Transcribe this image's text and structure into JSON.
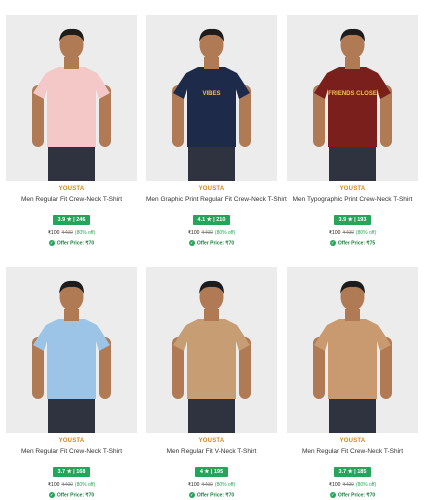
{
  "products": [
    {
      "brand": "YOUSTA",
      "name": "Men Regular Fit Crew-Neck T-Shirt",
      "rating": "3.9 ★ | 246",
      "price": "₹100",
      "mrp": "₹499",
      "discount": "(80% off)",
      "offer": "Offer Price: ₹70",
      "shirt_color": "#f3c8c6",
      "shirt_label": ""
    },
    {
      "brand": "YOUSTA",
      "name": "Men Graphic Print Regular Fit Crew-Neck T-Shirt",
      "rating": "4.1 ★ | 210",
      "price": "₹100",
      "mrp": "₹499",
      "discount": "(80% off)",
      "offer": "Offer Price: ₹70",
      "shirt_color": "#1e2a4a",
      "shirt_label": "VIBES"
    },
    {
      "brand": "YOUSTA",
      "name": "Men Typographic Print Crew-Neck T-Shirt",
      "rating": "3.9 ★ | 193",
      "price": "₹100",
      "mrp": "₹499",
      "discount": "(80% off)",
      "offer": "Offer Price: ₹75",
      "shirt_color": "#7a1f1c",
      "shirt_label": "FRIENDS CLOSE"
    },
    {
      "brand": "YOUSTA",
      "name": "Men Regular Fit Crew-Neck T-Shirt",
      "rating": "3.7 ★ | 168",
      "price": "₹100",
      "mrp": "₹499",
      "discount": "(80% off)",
      "offer": "Offer Price: ₹70",
      "shirt_color": "#9cc4e6",
      "shirt_label": ""
    },
    {
      "brand": "YOUSTA",
      "name": "Men Regular Fit V-Neck T-Shirt",
      "rating": "4 ★ | 195",
      "price": "₹100",
      "mrp": "₹499",
      "discount": "(80% off)",
      "offer": "Offer Price: ₹70",
      "shirt_color": "#c79e74",
      "shirt_label": ""
    },
    {
      "brand": "YOUSTA",
      "name": "Men Regular Fit Crew-Neck T-Shirt",
      "rating": "3.7 ★ | 185",
      "price": "₹100",
      "mrp": "₹499",
      "discount": "(80% off)",
      "offer": "Offer Price: ₹70",
      "shirt_color": "#c99a70",
      "shirt_label": ""
    }
  ]
}
